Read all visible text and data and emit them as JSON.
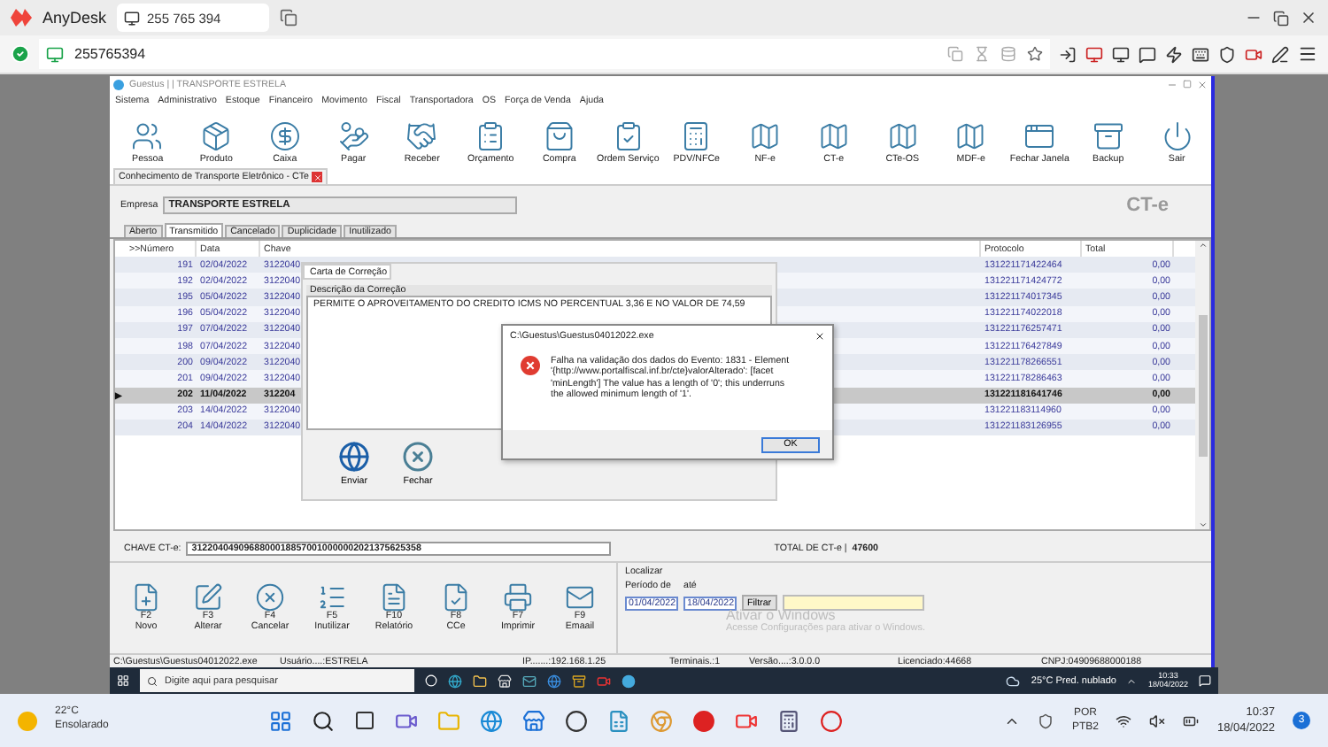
{
  "anydesk": {
    "app_name": "AnyDesk",
    "tab_label": "255 765 394",
    "address": "255765394"
  },
  "remote_window": {
    "title": "Guestus | | TRANSPORTE ESTRELA",
    "menu": [
      "Sistema",
      "Administrativo",
      "Estoque",
      "Financeiro",
      "Movimento",
      "Fiscal",
      "Transportadora",
      "OS",
      "Força de Venda",
      "Ajuda"
    ],
    "toolbar": [
      {
        "kind": "people",
        "label": "Pessoa"
      },
      {
        "kind": "product",
        "label": "Produto"
      },
      {
        "kind": "cash",
        "label": "Caixa"
      },
      {
        "kind": "pay",
        "label": "Pagar"
      },
      {
        "kind": "receive",
        "label": "Receber"
      },
      {
        "kind": "quote",
        "label": "Orçamento"
      },
      {
        "kind": "bag",
        "label": "Compra"
      },
      {
        "kind": "order",
        "label": "Ordem Serviço"
      },
      {
        "kind": "pos",
        "label": "PDV/NFCe"
      },
      {
        "kind": "map",
        "label": "NF-e"
      },
      {
        "kind": "map",
        "label": "CT-e"
      },
      {
        "kind": "map",
        "label": "CTe-OS"
      },
      {
        "kind": "map",
        "label": "MDF-e"
      },
      {
        "kind": "close",
        "label": "Fechar Janela"
      },
      {
        "kind": "backup",
        "label": "Backup"
      },
      {
        "kind": "power",
        "label": "Sair"
      }
    ],
    "doc_tab": "Conhecimento de Transporte Eletrônico - CTe",
    "company_label": "Empresa",
    "company": "TRANSPORTE ESTRELA",
    "module_badge": "CT-e",
    "tabs": [
      {
        "label": "Aberto",
        "selected": false
      },
      {
        "label": "Transmitido",
        "selected": true
      },
      {
        "label": "Cancelado",
        "selected": false
      },
      {
        "label": "Duplicidade",
        "selected": false
      },
      {
        "label": "Inutilizado",
        "selected": false
      }
    ],
    "table": {
      "row_pointer": "▶",
      "columns": [
        ">>Número",
        "Data",
        "Chave",
        "Protocolo",
        "Total"
      ],
      "rows": [
        {
          "numero": "191",
          "data": "02/04/2022",
          "chave": "3122040",
          "protocolo": "131221171422464",
          "total": "0,00",
          "selected": false
        },
        {
          "numero": "192",
          "data": "02/04/2022",
          "chave": "3122040",
          "protocolo": "131221171424772",
          "total": "0,00",
          "selected": false
        },
        {
          "numero": "195",
          "data": "05/04/2022",
          "chave": "3122040",
          "protocolo": "131221174017345",
          "total": "0,00",
          "selected": false
        },
        {
          "numero": "196",
          "data": "05/04/2022",
          "chave": "3122040",
          "protocolo": "131221174022018",
          "total": "0,00",
          "selected": false
        },
        {
          "numero": "197",
          "data": "07/04/2022",
          "chave": "3122040",
          "protocolo": "131221176257471",
          "total": "0,00",
          "selected": false
        },
        {
          "numero": "198",
          "data": "07/04/2022",
          "chave": "3122040",
          "protocolo": "131221176427849",
          "total": "0,00",
          "selected": false
        },
        {
          "numero": "200",
          "data": "09/04/2022",
          "chave": "3122040",
          "protocolo": "131221178266551",
          "total": "0,00",
          "selected": false
        },
        {
          "numero": "201",
          "data": "09/04/2022",
          "chave": "3122040",
          "protocolo": "131221178286463",
          "total": "0,00",
          "selected": false
        },
        {
          "numero": "202",
          "data": "11/04/2022",
          "chave": "312204",
          "protocolo": "131221181641746",
          "total": "0,00",
          "selected": true
        },
        {
          "numero": "203",
          "data": "14/04/2022",
          "chave": "3122040",
          "protocolo": "131221183114960",
          "total": "0,00",
          "selected": false
        },
        {
          "numero": "204",
          "data": "14/04/2022",
          "chave": "3122040",
          "protocolo": "131221183126955",
          "total": "0,00",
          "selected": false
        }
      ]
    },
    "chave_label": "CHAVE CT-e:",
    "chave_value": "31220404909688000188570010000002021375625358",
    "total_label": "TOTAL DE CT-e |",
    "total_value": "47600",
    "actions": [
      {
        "kind": "new",
        "key": "F2",
        "label": "Novo"
      },
      {
        "kind": "edit",
        "key": "F3",
        "label": "Alterar"
      },
      {
        "kind": "cancel",
        "key": "F4",
        "label": "Cancelar"
      },
      {
        "kind": "list",
        "key": "F5",
        "label": "Inutilizar"
      },
      {
        "kind": "report",
        "key": "F10",
        "label": "Relatório"
      },
      {
        "kind": "cce",
        "key": "F8",
        "label": "CCe"
      },
      {
        "kind": "print",
        "key": "F7",
        "label": "Imprimir"
      },
      {
        "kind": "mail",
        "key": "F9",
        "label": "Emaail"
      }
    ],
    "localizar": {
      "title": "Localizar",
      "from_label": "Período de",
      "to_label": "até",
      "from": "01/04/2022",
      "to": "18/04/2022",
      "filter_button": "Filtrar"
    },
    "status_bar": [
      "C:\\Guestus\\Guestus04012022.exe",
      "Usuário....:ESTRELA",
      "IP.......:192.168.1.25",
      "Terminais.:1",
      "Versão....:3.0.0.0",
      "Licenciado:44668",
      "CNPJ:04909688000188"
    ]
  },
  "correction_panel": {
    "tab": "Carta de Correção",
    "label": "Descrição da Correção",
    "text": "PERMITE O APROVEITAMENTO DO CREDITO ICMS NO PERCENTUAL 3,36 E NO VALOR DE 74,59",
    "buttons": [
      {
        "kind": "send",
        "label": "Enviar"
      },
      {
        "kind": "close",
        "label": "Fechar"
      }
    ]
  },
  "error_dialog": {
    "title": "C:\\Guestus\\Guestus04012022.exe",
    "message": "Falha na validação dos dados do Evento: 1831 - Element '{http://www.portalfiscal.inf.br/cte}valorAlterado': [facet 'minLength'] The value has a length of '0'; this underruns the allowed minimum length of '1'.",
    "button": "OK"
  },
  "activation_notice": {
    "title": "Ativar o Windows",
    "subtitle": "Acesse Configurações para ativar o Windows."
  },
  "remote_taskbar": {
    "search_placeholder": "Digite aqui para pesquisar",
    "weather": "25°C  Pred. nublado",
    "time": "10:33",
    "date": "18/04/2022"
  },
  "taskbar": {
    "temperature": "22°C",
    "condition": "Ensolarado",
    "language": "POR",
    "layout": "PTB2",
    "time": "10:37",
    "date": "18/04/2022",
    "notification_count": "3"
  }
}
